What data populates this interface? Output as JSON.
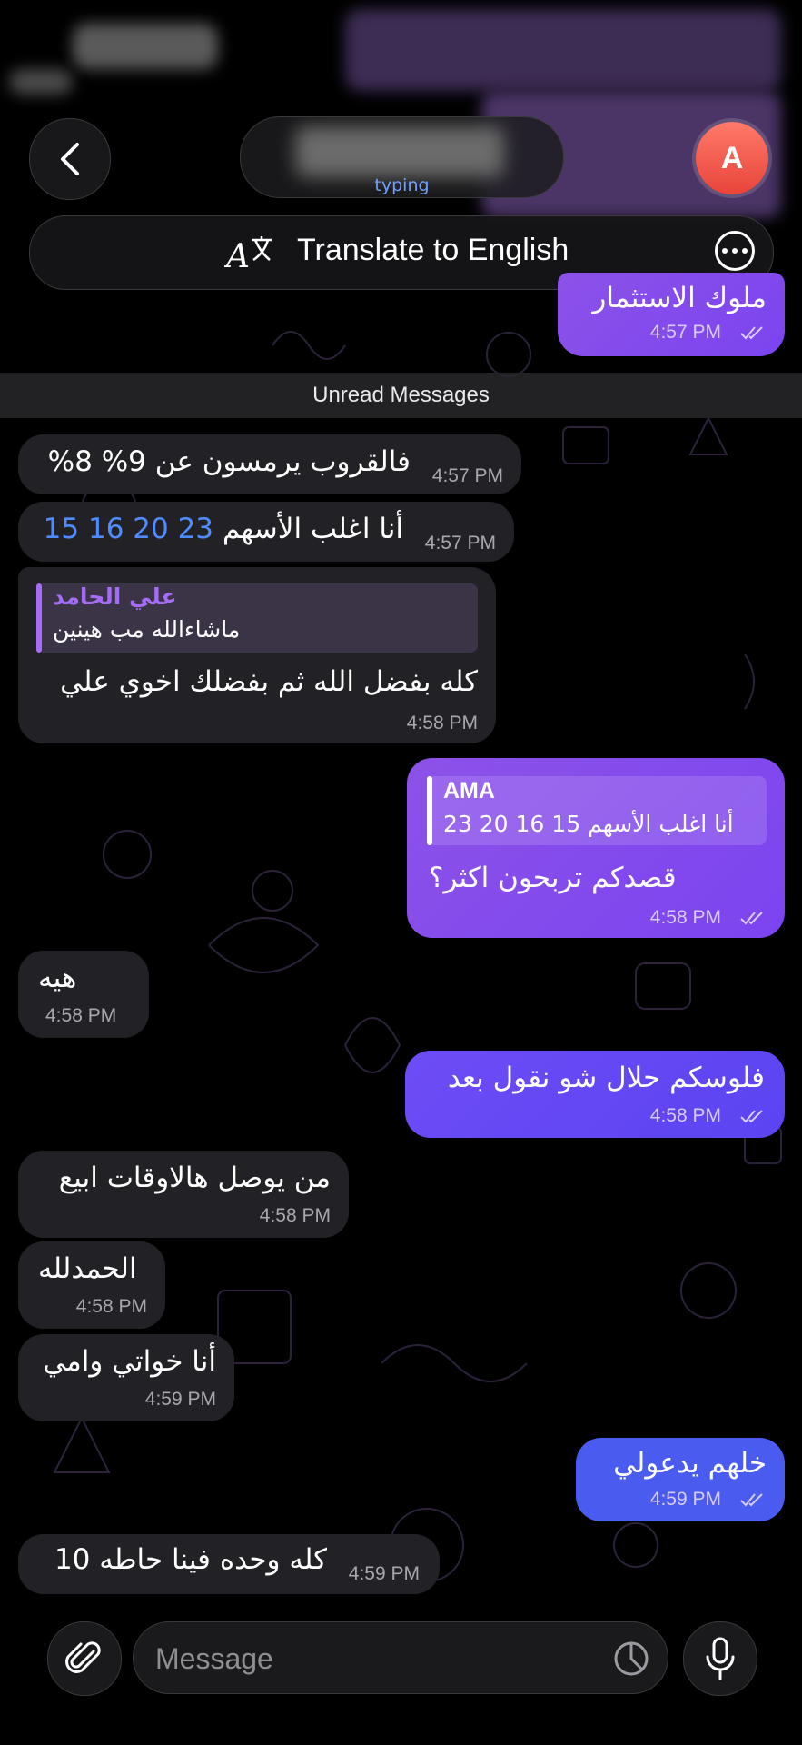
{
  "header": {
    "status_text": "typing",
    "avatar_initial": "A"
  },
  "translate_bar": {
    "label": "Translate to English"
  },
  "unread_divider": "Unread Messages",
  "messages": [
    {
      "direction": "out",
      "text": "ملوك الاستثمار",
      "time": "4:57 PM",
      "read": true
    },
    {
      "direction": "in",
      "text": "فالقروب يرمسون عن 9% 8%",
      "time": "4:57 PM"
    },
    {
      "direction": "in",
      "text_prefix": "أنا اغلب الأسهم",
      "text_highlight": "15 16 20 23",
      "time": "4:57 PM"
    },
    {
      "direction": "in",
      "reply_author": "علي الحامد",
      "reply_text": "ماشاءالله مب هينين",
      "text": "كله بفضل الله ثم بفضلك اخوي علي",
      "time": "4:58 PM"
    },
    {
      "direction": "out",
      "reply_author": "AMA",
      "reply_text": "أنا اغلب الأسهم 15 16 20 23",
      "text": "قصدكم تربحون اكثر؟",
      "time": "4:58 PM",
      "read": true
    },
    {
      "direction": "in",
      "text": "هيه",
      "time": "4:58 PM"
    },
    {
      "direction": "out",
      "text": "فلوسكم حلال شو نقول بعد",
      "time": "4:58 PM",
      "read": true
    },
    {
      "direction": "in",
      "text": "من يوصل هالاوقات ابيع",
      "time": "4:58 PM"
    },
    {
      "direction": "in",
      "text": "الحمدلله",
      "time": "4:58 PM"
    },
    {
      "direction": "in",
      "text": "أنا خواتي وامي",
      "time": "4:59 PM"
    },
    {
      "direction": "out",
      "text": "خلهم يدعولي",
      "time": "4:59 PM",
      "read": true
    },
    {
      "direction": "in",
      "text": "كله وحده فينا حاطه 10",
      "time": "4:59 PM"
    }
  ],
  "composer": {
    "placeholder": "Message"
  },
  "colors": {
    "background": "#000000",
    "incoming_bubble": "#222226",
    "outgoing_bubble": "#8c52e8",
    "outgoing_bubble_last": "#4a5cf0",
    "link_blue": "#4f8cff",
    "reply_author_purple": "#a56cf5",
    "avatar_red": "#e8443a"
  },
  "icons": [
    "back-chevron-icon",
    "translate-icon",
    "more-icon",
    "read-check-icon",
    "attach-paperclip-icon",
    "sticker-icon",
    "microphone-icon"
  ]
}
